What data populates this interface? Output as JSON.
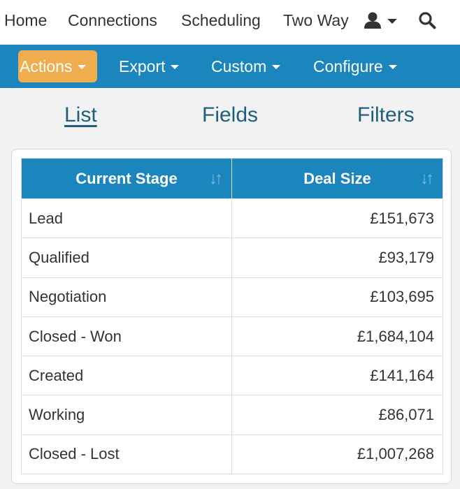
{
  "topnav": {
    "home": "Home",
    "connections": "Connections",
    "scheduling": "Scheduling",
    "two_way": "Two Way",
    "user_icon": "user-icon",
    "search_icon": "search-icon"
  },
  "toolbar": {
    "actions": "Actions",
    "export": "Export",
    "custom": "Custom",
    "configure": "Configure",
    "actions_color": "#f0ad4e",
    "bar_color": "#1a86bd"
  },
  "tabs": {
    "list": "List",
    "fields": "Fields",
    "filters": "Filters",
    "active": "List"
  },
  "table": {
    "headers": [
      "Current Stage",
      "Deal Size"
    ],
    "rows": [
      [
        "Lead",
        "£151,673"
      ],
      [
        "Qualified",
        "£93,179"
      ],
      [
        "Negotiation",
        "£103,695"
      ],
      [
        "Closed - Won",
        "£1,684,104"
      ],
      [
        "Created",
        "£141,164"
      ],
      [
        "Working",
        "£86,071"
      ],
      [
        "Closed - Lost",
        "£1,007,268"
      ]
    ]
  }
}
